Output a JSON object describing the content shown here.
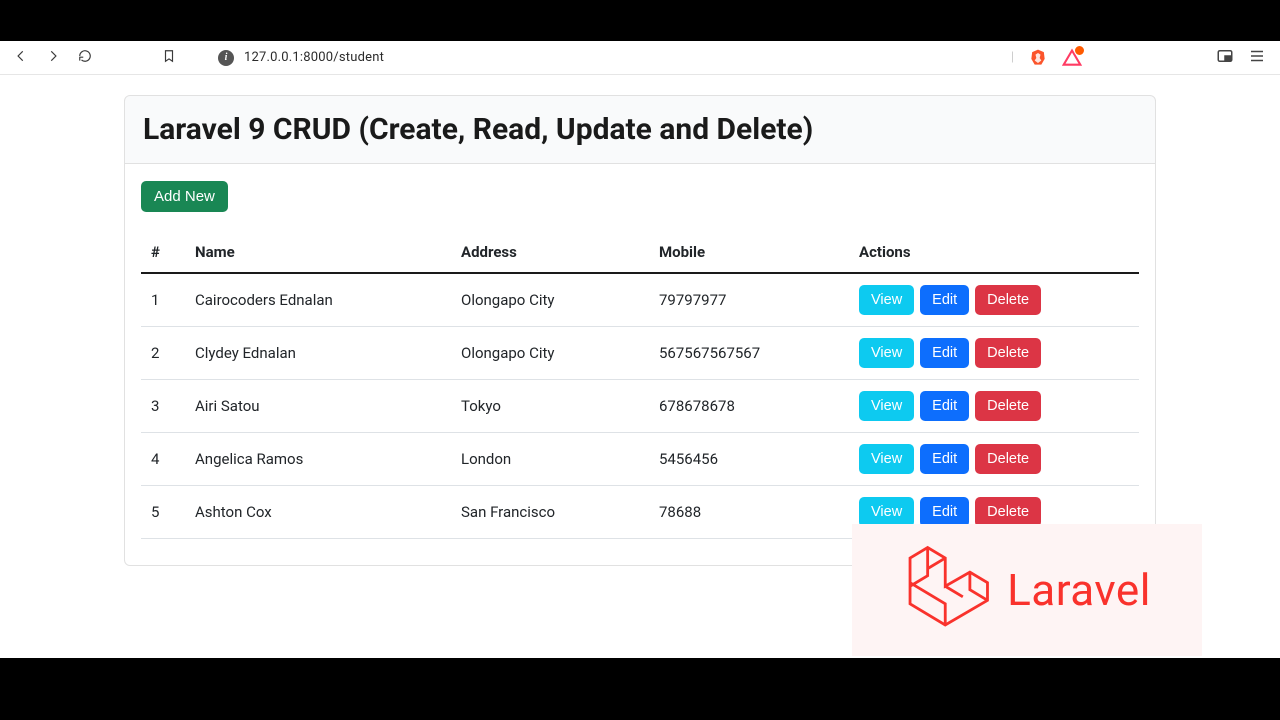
{
  "browser": {
    "url": "127.0.0.1:8000/student"
  },
  "page": {
    "title": "Laravel 9 CRUD (Create, Read, Update and Delete)",
    "add_button": "Add New",
    "table": {
      "headers": {
        "index": "#",
        "name": "Name",
        "address": "Address",
        "mobile": "Mobile",
        "actions": "Actions"
      },
      "actions": {
        "view": "View",
        "edit": "Edit",
        "delete": "Delete"
      },
      "rows": [
        {
          "index": "1",
          "name": "Cairocoders Ednalan",
          "address": "Olongapo City",
          "mobile": "79797977"
        },
        {
          "index": "2",
          "name": "Clydey Ednalan",
          "address": "Olongapo City",
          "mobile": "567567567567"
        },
        {
          "index": "3",
          "name": "Airi Satou",
          "address": "Tokyo",
          "mobile": "678678678"
        },
        {
          "index": "4",
          "name": "Angelica Ramos",
          "address": "London",
          "mobile": "5456456"
        },
        {
          "index": "5",
          "name": "Ashton Cox",
          "address": "San Francisco",
          "mobile": "78688"
        }
      ]
    }
  },
  "logo": {
    "text": "Laravel"
  }
}
